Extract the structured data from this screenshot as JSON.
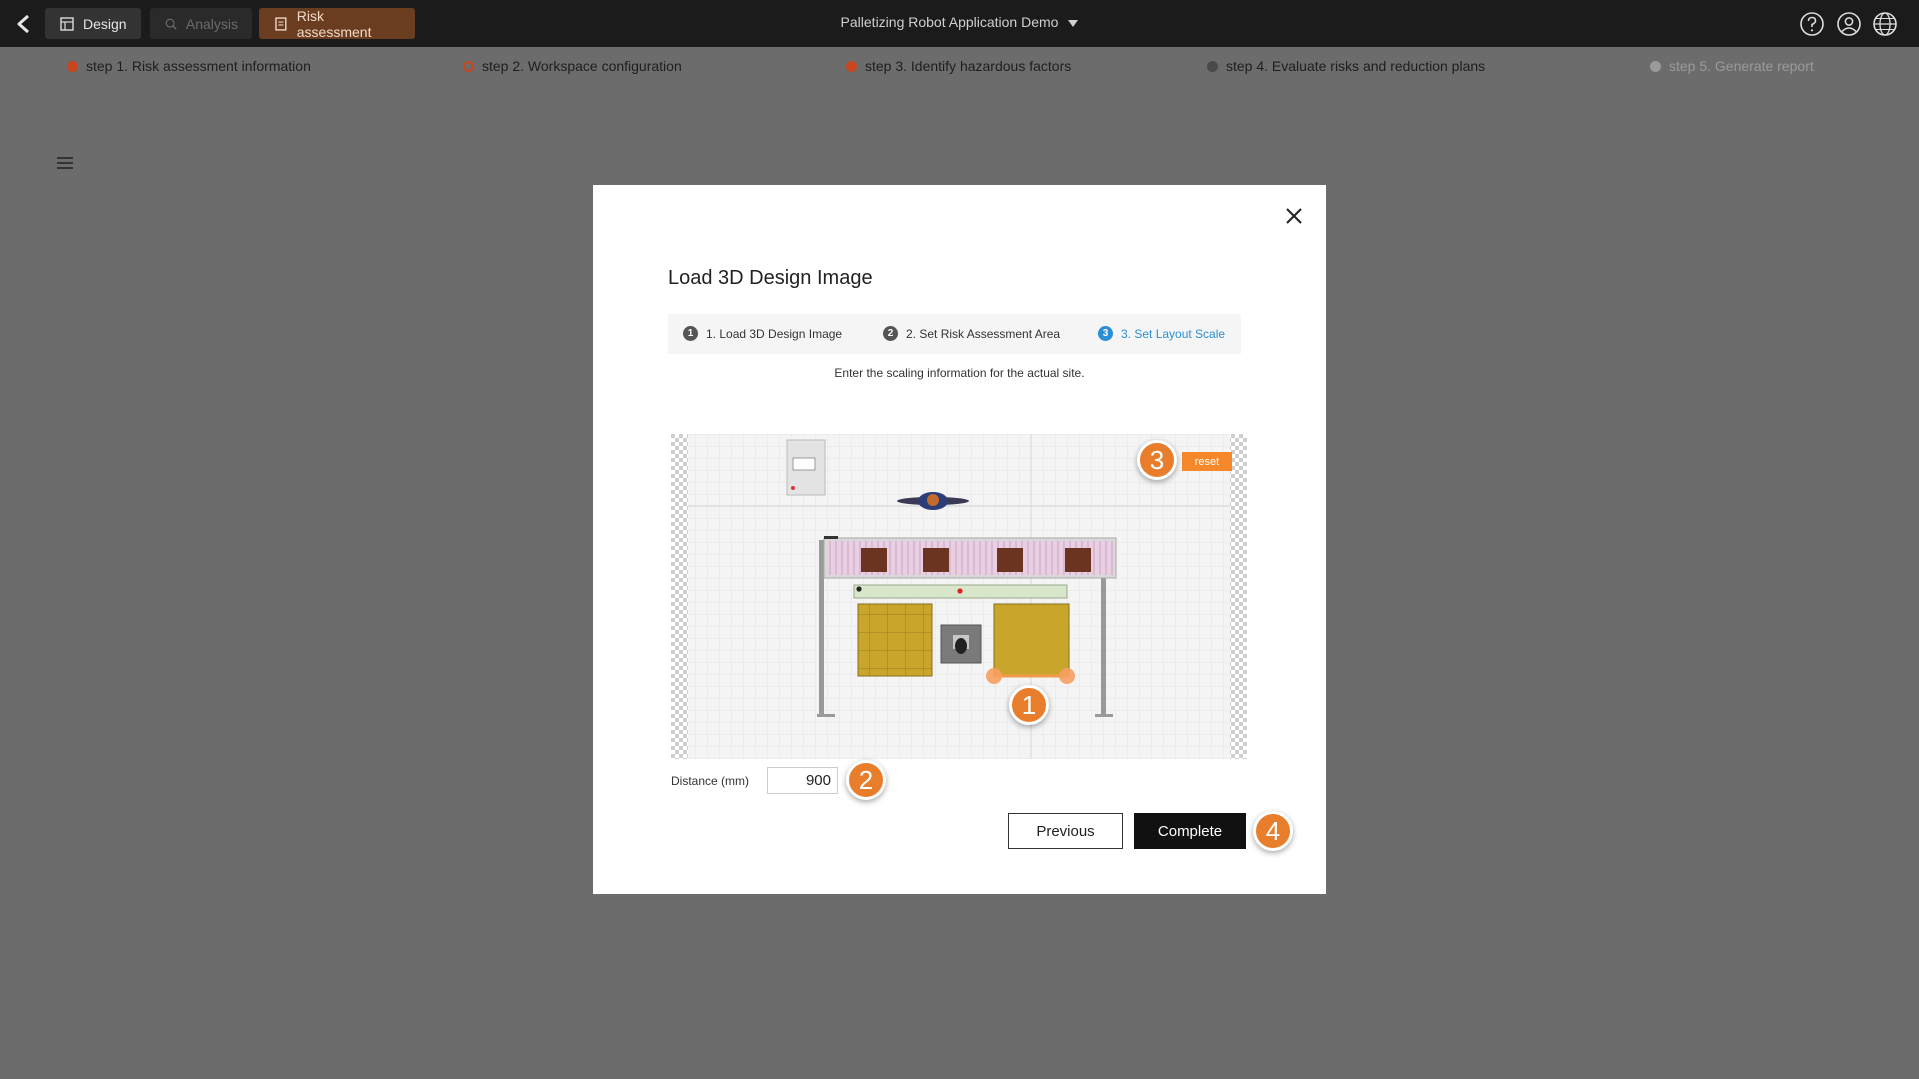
{
  "topbar": {
    "tabs": [
      {
        "label": "Design",
        "icon": "design-icon"
      },
      {
        "label": "Analysis",
        "icon": "analysis-icon"
      },
      {
        "label": "Risk assessment",
        "icon": "document-icon"
      }
    ],
    "project_title": "Palletizing Robot Application Demo",
    "right_icons": [
      "help-icon",
      "user-icon",
      "globe-icon"
    ]
  },
  "steps": [
    {
      "label": "step 1. Risk assessment information",
      "color": "#c8461f",
      "state": "done"
    },
    {
      "label": "step 2. Workspace configuration",
      "color": "#c8461f",
      "state": "current"
    },
    {
      "label": "step 3. Identify hazardous factors",
      "color": "#c8461f",
      "state": "done"
    },
    {
      "label": "step 4. Evaluate risks and reduction plans",
      "color": "#4a4a4a",
      "state": "pending"
    },
    {
      "label": "step 5. Generate report",
      "color": "#9a9a9a",
      "state": "disabled"
    }
  ],
  "modal": {
    "title": "Load 3D Design Image",
    "wizard_steps": [
      {
        "num": "1",
        "label": "1. Load 3D Design Image"
      },
      {
        "num": "2",
        "label": "2. Set Risk Assessment Area"
      },
      {
        "num": "3",
        "label": "3. Set Layout Scale"
      }
    ],
    "instruction": "Enter the scaling information for the actual site.",
    "reset_label": "reset",
    "distance_label": "Distance (mm)",
    "distance_value": "900",
    "previous_label": "Previous",
    "complete_label": "Complete",
    "badges": [
      "1",
      "2",
      "3",
      "4"
    ]
  },
  "colors": {
    "accent_orange": "#e87e2c",
    "active_blue": "#2b8fd6",
    "risk_tab": "#6b3d20"
  }
}
